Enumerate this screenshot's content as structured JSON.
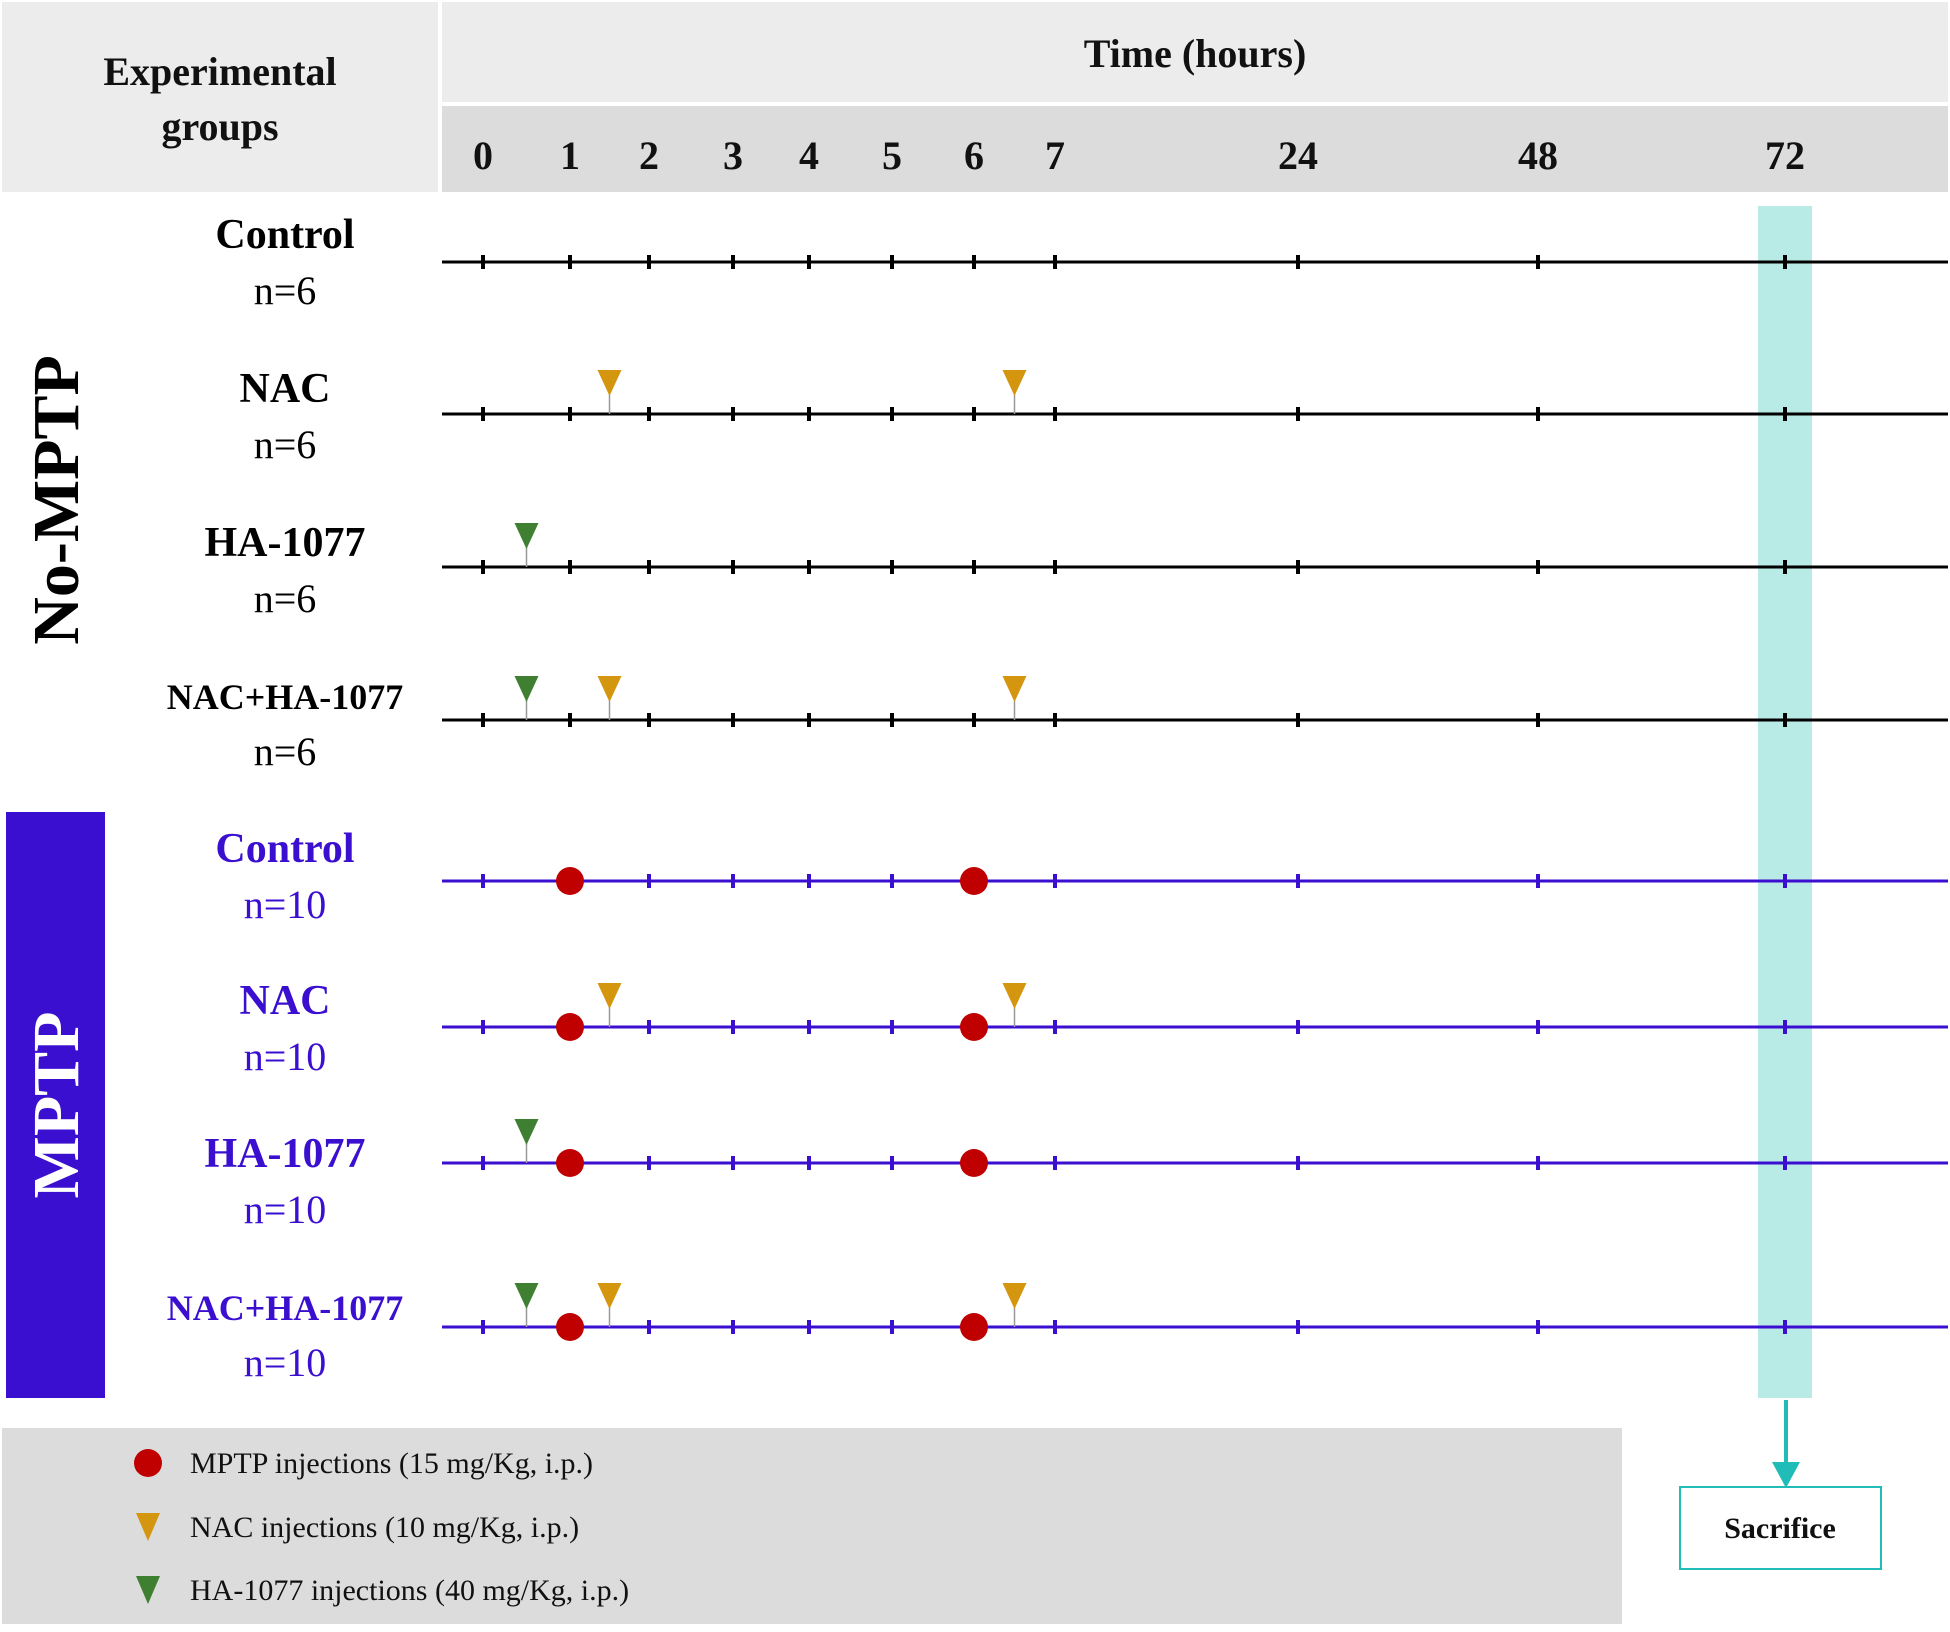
{
  "header": {
    "groups_label_line1": "Experimental",
    "groups_label_line2": "groups",
    "time_label": "Time (hours)",
    "ticks": [
      "0",
      "1",
      "2",
      "3",
      "4",
      "5",
      "6",
      "7",
      "24",
      "48",
      "72"
    ]
  },
  "sections": [
    {
      "label": "No-MPTP",
      "color": "#000000",
      "rows": [
        {
          "name": "Control",
          "n": "n=6",
          "mptp": [],
          "nac": [],
          "ha": []
        },
        {
          "name": "NAC",
          "n": "n=6",
          "mptp": [],
          "nac": [
            1.5,
            6.5
          ],
          "ha": []
        },
        {
          "name": "HA-1077",
          "n": "n=6",
          "mptp": [],
          "nac": [],
          "ha": [
            0.5
          ]
        },
        {
          "name": "NAC+HA-1077",
          "n": "n=6",
          "mptp": [],
          "nac": [
            1.5,
            6.5
          ],
          "ha": [
            0.5
          ]
        }
      ]
    },
    {
      "label": "MPTP",
      "color": "#3a0fd0",
      "rows": [
        {
          "name": "Control",
          "n": "n=10",
          "mptp": [
            1,
            6
          ],
          "nac": [],
          "ha": []
        },
        {
          "name": "NAC",
          "n": "n=10",
          "mptp": [
            1,
            6
          ],
          "nac": [
            1.5,
            6.5
          ],
          "ha": []
        },
        {
          "name": "HA-1077",
          "n": "n=10",
          "mptp": [
            1,
            6
          ],
          "nac": [],
          "ha": [
            0.5
          ]
        },
        {
          "name": "NAC+HA-1077",
          "n": "n=10",
          "mptp": [
            1,
            6
          ],
          "nac": [
            1.5,
            6.5
          ],
          "ha": [
            0.5
          ]
        }
      ]
    }
  ],
  "legend": [
    {
      "shape": "circle",
      "color": "#c00000",
      "text": "MPTP injections (15 mg/Kg, i.p.)"
    },
    {
      "shape": "triangle",
      "color": "#d4960f",
      "text": "NAC injections (10 mg/Kg, i.p.)"
    },
    {
      "shape": "triangle",
      "color": "#3f7f32",
      "text": "HA-1077 injections (40 mg/Kg, i.p.)"
    }
  ],
  "sacrifice": {
    "time": "72",
    "label": "Sacrifice",
    "color": "#b8eae6",
    "arrow_color": "#1fbcb8"
  }
}
